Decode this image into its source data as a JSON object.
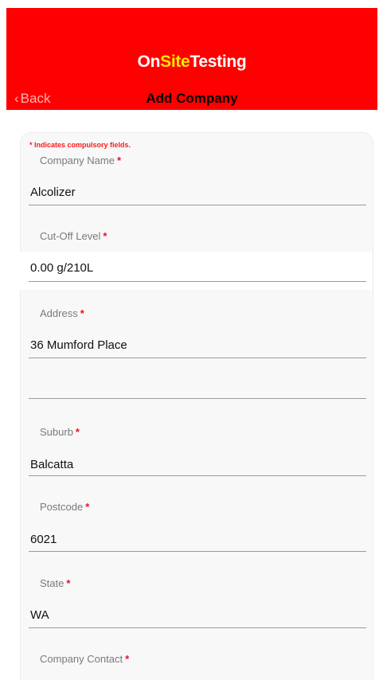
{
  "header": {
    "logo_on": "On",
    "logo_site": "Site",
    "logo_testing": "Testing",
    "back_chevron": "‹",
    "back_label": "Back",
    "title": "Add Company"
  },
  "form": {
    "note": "* Indicates compulsory fields.",
    "required_mark": "*",
    "company_name": {
      "label": "Company Name",
      "value": "Alcolizer"
    },
    "cutoff_level": {
      "label": "Cut-Off Level",
      "value": "0.00 g/210L"
    },
    "address": {
      "label": "Address",
      "value": "36 Mumford Place",
      "line2": ""
    },
    "suburb": {
      "label": "Suburb",
      "value": "Balcatta"
    },
    "postcode": {
      "label": "Postcode",
      "value": "6021"
    },
    "state": {
      "label": "State",
      "value": "WA"
    },
    "company_contact": {
      "label": "Company Contact"
    }
  },
  "colors": {
    "header_red": "#ff0000",
    "logo_yellow": "#ffe600",
    "required_red": "#e8102a"
  }
}
